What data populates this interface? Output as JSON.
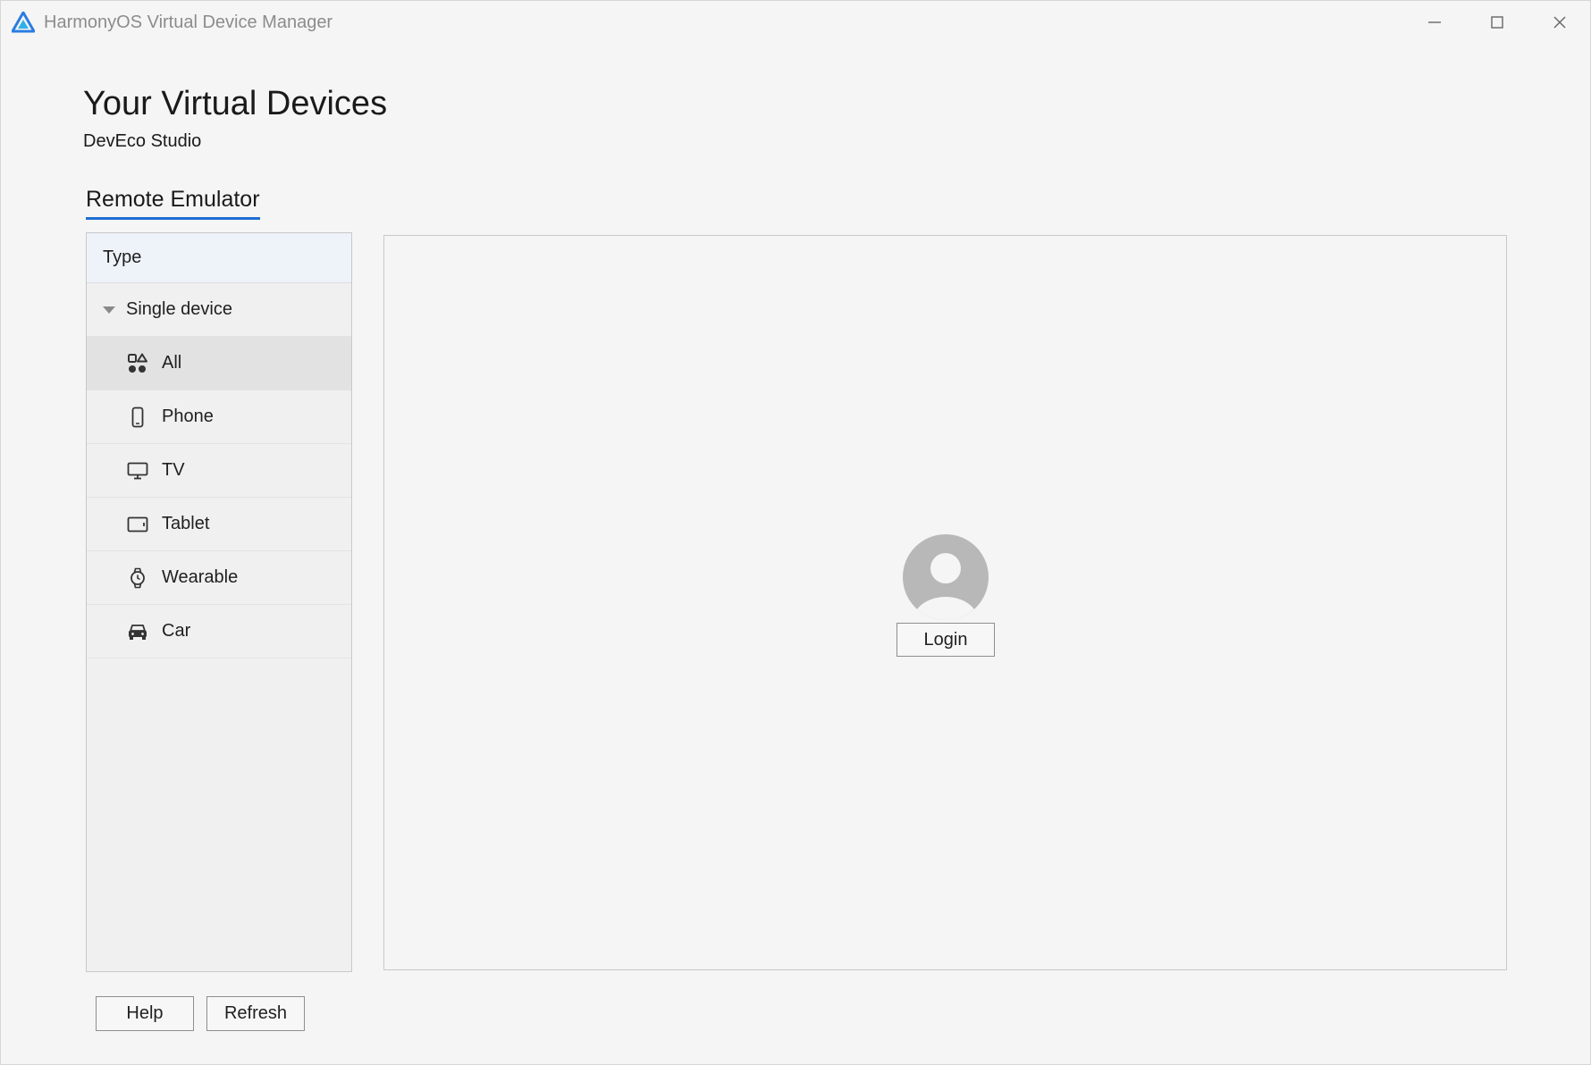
{
  "window": {
    "title": "HarmonyOS Virtual Device Manager",
    "controls": [
      "minimize-icon",
      "maximize-icon",
      "close-icon"
    ]
  },
  "header": {
    "title": "Your Virtual Devices",
    "subtitle": "DevEco Studio"
  },
  "tabs": [
    {
      "label": "Remote Emulator",
      "active": true
    }
  ],
  "type_panel": {
    "header": "Type",
    "group": {
      "label": "Single device",
      "expanded": true
    },
    "items": [
      {
        "label": "All",
        "icon": "all-apps-icon",
        "selected": true
      },
      {
        "label": "Phone",
        "icon": "phone-icon",
        "selected": false
      },
      {
        "label": "TV",
        "icon": "tv-icon",
        "selected": false
      },
      {
        "label": "Tablet",
        "icon": "tablet-icon",
        "selected": false
      },
      {
        "label": "Wearable",
        "icon": "watch-icon",
        "selected": false
      },
      {
        "label": "Car",
        "icon": "car-icon",
        "selected": false
      }
    ]
  },
  "content": {
    "avatar_icon": "user-avatar-icon",
    "login_label": "Login"
  },
  "footer": {
    "help_label": "Help",
    "refresh_label": "Refresh"
  },
  "colors": {
    "accent": "#1f6ed4",
    "background": "#f5f5f5",
    "selected_row": "#e2e2e2",
    "avatar": "#b8b8b8"
  }
}
